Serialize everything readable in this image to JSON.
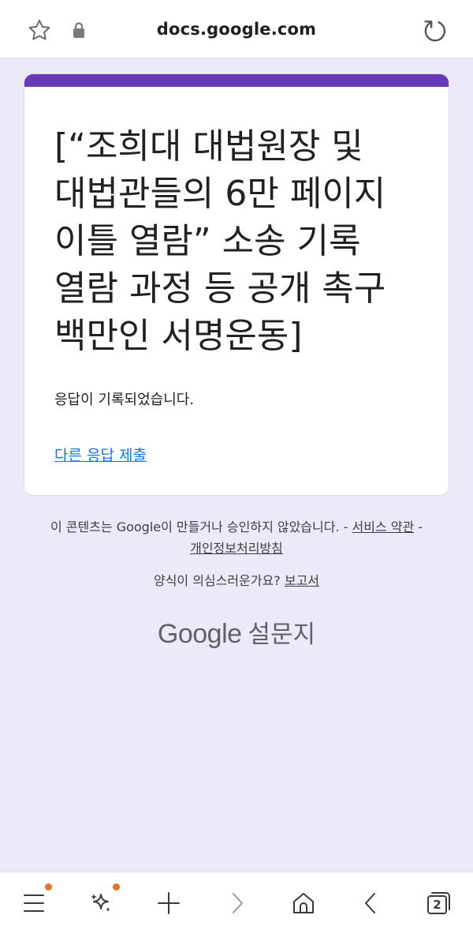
{
  "browser": {
    "url": "docs.google.com",
    "tab_count": "2",
    "icons": [
      "star-icon",
      "lock-icon",
      "reload-icon",
      "menu-icon",
      "sparkle-icon",
      "plus-icon",
      "forward-icon",
      "home-icon",
      "back-icon",
      "tabs-icon"
    ],
    "notification_dot_color": "#ec6f2a"
  },
  "form": {
    "title": "[“조희대 대법원장 및 대법관들의 6만 페이지 이틀 열람” 소송 기록 열람 과정 등 공개 촉구 백만인 서명운동]",
    "confirmation": "응답이 기록되었습니다.",
    "resubmit_link": "다른 응답 제출",
    "accent_color": "#673ab7"
  },
  "footer": {
    "disclaimer": "이 콘텐츠는 Google이 만들거나 승인하지 않았습니다. - ",
    "terms_link": "서비스 약관",
    "separator": " - ",
    "privacy_link": "개인정보처리방침",
    "suspicious_question": "양식이 의심스러운가요? ",
    "report_link": "보고서",
    "brand_google": "Google",
    "brand_forms": "설문지"
  }
}
